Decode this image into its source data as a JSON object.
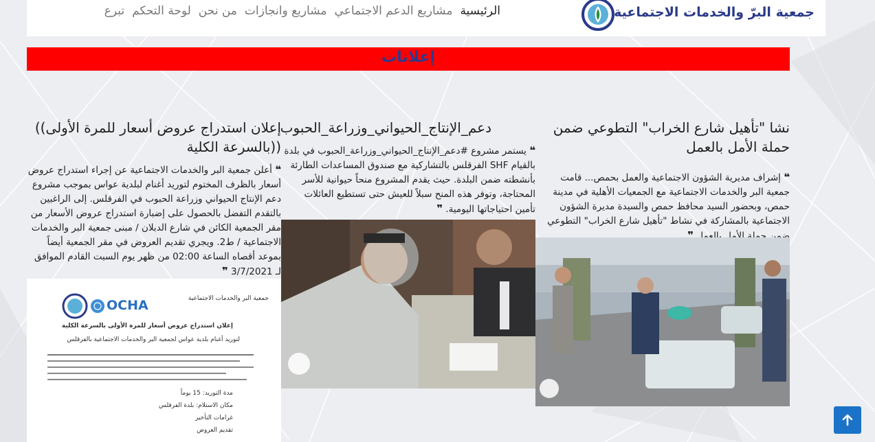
{
  "header": {
    "logo_text": "جمعية البرّ والخدمات الاجتماعية",
    "nav": [
      {
        "label": "الرئيسية"
      },
      {
        "label": "مشاريع الدعم الاجتماعي"
      },
      {
        "label": "مشاريع وانجازات"
      },
      {
        "label": "من نحن"
      },
      {
        "label": "لوحة التحكم"
      },
      {
        "label": "تبرع"
      }
    ]
  },
  "banner": {
    "title": "إعلانات"
  },
  "posts": [
    {
      "title": "نشا \"تأهيل شارع الخراب\" التطوعي ضمن حملة الأمل بالعمل",
      "excerpt": "إشراف مديرية الشؤون الاجتماعية والعمل بحمص... قامت جمعية البر والخدمات الاجتماعية مع الجمعيات الأهلية في مدينة حمص، وبحضور السيد محافظ حمص والسيدة مديرة الشؤون الاجتماعية بالمشاركة في نشاط \"تأهيل شارع الخراب\" التطوعي ضمن حملة الأمل بالعمل",
      "image_alt": "volunteers-painting-bench"
    },
    {
      "title": "دعم_الإنتاج_الحيواني_وزراعة_الحبوب",
      "excerpt": "يستمر مشروع #دعم_الإنتاج_الحيواني_وزراعة_الحبوب في بلدة بالقيام SHF الفرقلس بالتشاركية مع صندوق المساعدات الطارئة بأنشطته ضمن البلدة. حيث يقدم المشروع منحاً حيوانية للأسر المحتاجة، وتوفر هذه المنح سبلاً للعيش حتى تستطيع العائلات تأمين احتياجاتها اليومية.",
      "image_alt": "aid-worker-registration"
    },
    {
      "title": "إعلان استدراج عروض أسعار للمرة الأولى)) ((بالسرعة الكلية",
      "excerpt": "أعلن جمعية البر والخدمات الاجتماعية عن إجراء استدراج عروض أسعار بالظرف المختوم لتوريد أغنام لبلدية عواس بموجب مشروع دعم الإنتاج الحيواني وزراعة الحبوب في الفرقلس. إلى الراغبين بالتقدم التفضل بالحصول على إضبارة استدراج عروض الأسعار من مقر الجمعية الكائن في شارع الدبلان / مبنى جمعية البر والخدمات الاجتماعية / ط2. ويجري تقديم العروض في مقر الجمعية أيضاً بموعد أقصاه الساعة 02:00 من ظهر يوم السبت القادم الموافق لـ 3/7/2021",
      "image_alt": "tender-announcement-document",
      "doc": {
        "org_left": "OCHA",
        "header_right": "جمعية البر والخدمات الاجتماعية",
        "doc_title": "إعلان استدراج عروض أسعار للمرة الأولى بالسرعة الكلية",
        "doc_subtitle": "لتوريد أغنام بلدية عواس لجمعية البر والخدمات الاجتماعية بالفرقلس",
        "items": [
          "مدة التوريد: 15 يوماً",
          "مكان الاستلام: بلدة الفرقلس",
          "غرامات التأخير",
          "تقديم العروض"
        ]
      }
    }
  ],
  "scroll_top": {
    "icon": "arrow-up-icon"
  },
  "colors": {
    "banner": "#ff0000",
    "banner_text": "#2e3a8c",
    "scroll_btn": "#1a73c8"
  }
}
